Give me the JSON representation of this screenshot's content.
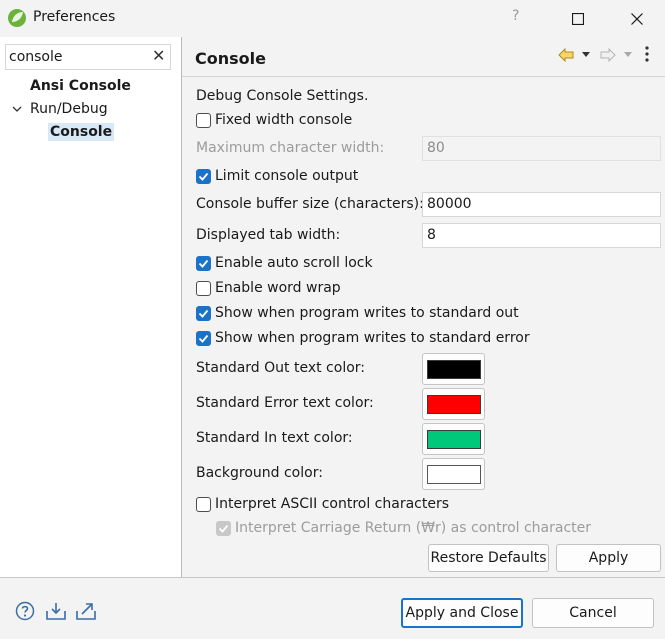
{
  "window": {
    "title": "Preferences",
    "help_glyph": "?"
  },
  "filter": {
    "value": "console",
    "clear_glyph": "✕"
  },
  "tree": {
    "ansi_console": "Ansi Console",
    "run_debug": "Run/Debug",
    "console": "Console"
  },
  "page": {
    "title": "Console",
    "heading": "Debug Console Settings.",
    "fixed_width": "Fixed width console",
    "max_char_width_label": "Maximum character width:",
    "max_char_width_value": "80",
    "limit_output": "Limit console output",
    "buffer_size_label": "Console buffer size (characters):",
    "buffer_size_value": "80000",
    "tab_width_label": "Displayed tab width:",
    "tab_width_value": "8",
    "auto_scroll_lock": "Enable auto scroll lock",
    "word_wrap": "Enable word wrap",
    "show_stdout": "Show when program writes to standard out",
    "show_stderr": "Show when program writes to standard error",
    "stdout_color_label": "Standard Out text color:",
    "stderr_color_label": "Standard Error text color:",
    "stdin_color_label": "Standard In text color:",
    "bg_color_label": "Background color:",
    "interpret_ascii": "Interpret ASCII control characters",
    "interpret_cr": "Interpret Carriage Return (₩r) as control character"
  },
  "colors": {
    "stdout": "#000000",
    "stderr": "#ff0000",
    "stdin": "#00c87a",
    "background": "#ffffff",
    "accent": "#1a73c8"
  },
  "checkboxes": {
    "fixed_width": false,
    "limit_output": true,
    "auto_scroll_lock": true,
    "word_wrap": false,
    "show_stdout": true,
    "show_stderr": true,
    "interpret_ascii": false,
    "interpret_cr": true
  },
  "buttons": {
    "restore_defaults": "Restore Defaults",
    "apply": "Apply",
    "apply_and_close": "Apply and Close",
    "cancel": "Cancel"
  }
}
